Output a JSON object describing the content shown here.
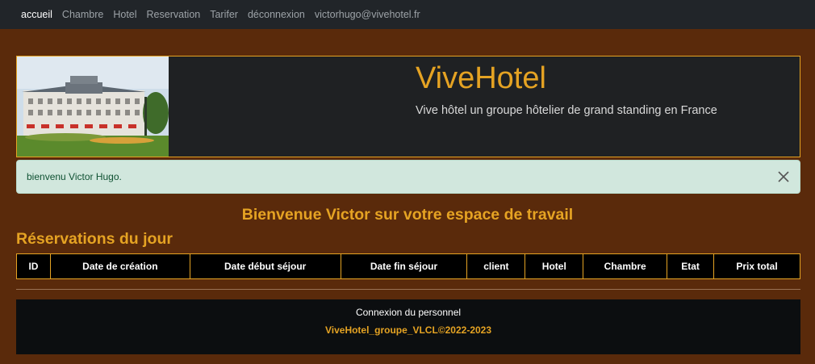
{
  "nav": {
    "items": [
      {
        "label": "accueil",
        "active": true
      },
      {
        "label": "Chambre",
        "active": false
      },
      {
        "label": "Hotel",
        "active": false
      },
      {
        "label": "Reservation",
        "active": false
      },
      {
        "label": "Tarifer",
        "active": false
      },
      {
        "label": "déconnexion",
        "active": false
      },
      {
        "label": "victorhugo@vivehotel.fr",
        "active": false
      }
    ]
  },
  "hero": {
    "title": "ViveHotel",
    "subtitle": "Vive hôtel un groupe hôtelier de grand standing en France"
  },
  "alert": {
    "message": "bienvenu Victor Hugo."
  },
  "welcome": "Bienvenue Victor sur votre espace de travail",
  "reservations": {
    "title": "Réservations du jour",
    "columns": [
      "ID",
      "Date de création",
      "Date début séjour",
      "Date fin séjour",
      "client",
      "Hotel",
      "Chambre",
      "Etat",
      "Prix total"
    ]
  },
  "footer": {
    "staff_login": "Connexion du personnel",
    "copyright": "ViveHotel_groupe_VLCL©2022-2023"
  },
  "colors": {
    "background": "#5a2a0b",
    "accent": "#e5a323",
    "navbar": "#212529",
    "alert_bg": "#d1e7dd"
  }
}
